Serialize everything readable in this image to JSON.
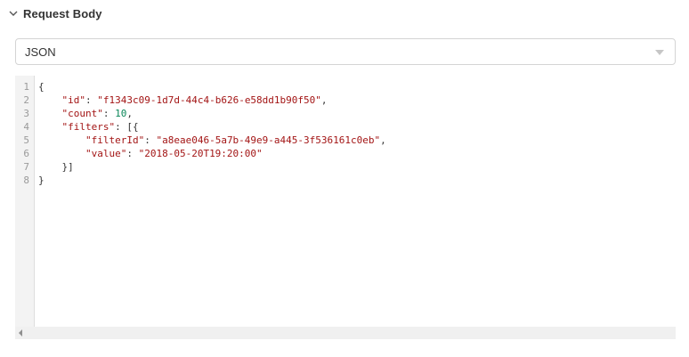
{
  "section": {
    "title": "Request Body",
    "toggle_icon": "chevron-down-icon"
  },
  "format_select": {
    "value": "JSON",
    "caret_icon": "caret-down-icon"
  },
  "editor": {
    "lines": [
      {
        "num": "1",
        "text": "{"
      },
      {
        "num": "2",
        "text": "    \"id\": \"f1343c09-1d7d-44c4-b626-e58dd1b90f50\","
      },
      {
        "num": "3",
        "text": "    \"count\": 10,"
      },
      {
        "num": "4",
        "text": "    \"filters\": [{"
      },
      {
        "num": "5",
        "text": "        \"filterId\": \"a8eae046-5a7b-49e9-a445-3f536161c0eb\","
      },
      {
        "num": "6",
        "text": "        \"value\": \"2018-05-20T19:20:00\""
      },
      {
        "num": "7",
        "text": "    }]"
      },
      {
        "num": "8",
        "text": "}"
      }
    ],
    "colors": {
      "string": "#a31515",
      "number": "#098658",
      "punctuation": "#333333"
    }
  },
  "scrollbar": {
    "left_arrow_icon": "scroll-left-arrow-icon"
  }
}
